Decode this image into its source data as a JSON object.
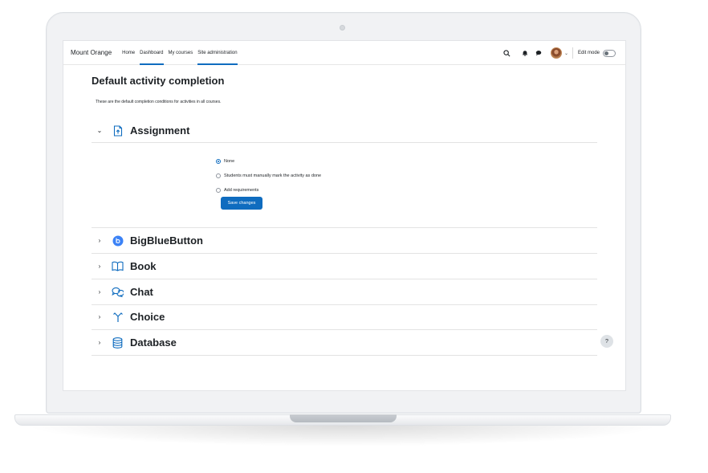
{
  "navbar": {
    "brand": "Mount Orange",
    "links": [
      {
        "label": "Home",
        "active": false
      },
      {
        "label": "Dashboard",
        "active": true
      },
      {
        "label": "My courses",
        "active": false
      },
      {
        "label": "Site administration",
        "active": true
      }
    ],
    "edit_mode_label": "Edit mode",
    "icons": [
      "search-icon",
      "bell-icon",
      "chat-icon",
      "avatar",
      "chevron-down-icon"
    ]
  },
  "page": {
    "title": "Default activity completion",
    "intro": "These are the default completion conditions for activities in all courses."
  },
  "modules": [
    {
      "name": "Assignment",
      "icon": "assignment-icon",
      "expanded": true
    },
    {
      "name": "BigBlueButton",
      "icon": "bigbluebutton-icon",
      "expanded": false
    },
    {
      "name": "Book",
      "icon": "book-icon",
      "expanded": false
    },
    {
      "name": "Chat",
      "icon": "chat-bubbles-icon",
      "expanded": false
    },
    {
      "name": "Choice",
      "icon": "choice-icon",
      "expanded": false
    },
    {
      "name": "Database",
      "icon": "database-icon",
      "expanded": false
    }
  ],
  "completion_options": [
    {
      "label": "None",
      "selected": true
    },
    {
      "label": "Students must manually mark the activity as done",
      "selected": false
    },
    {
      "label": "Add requirements",
      "selected": false
    }
  ],
  "save_label": "Save changes",
  "help_label": "?",
  "colors": {
    "accent": "#0f6cbf",
    "bigbluebutton": "#3b82f6"
  }
}
